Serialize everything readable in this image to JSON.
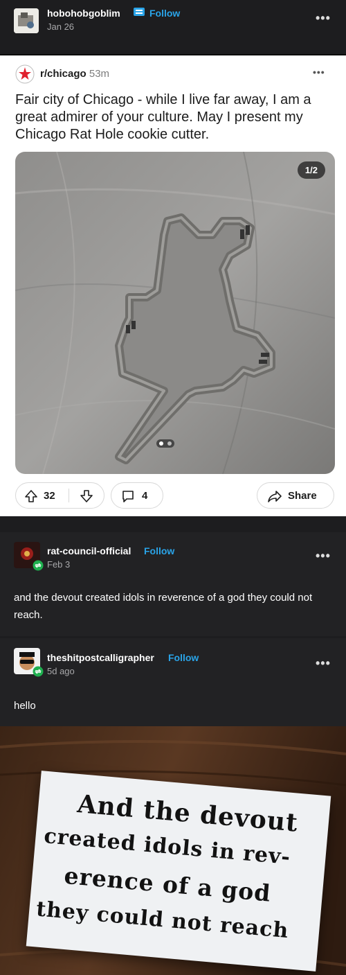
{
  "original_post": {
    "username": "hobohobgoblim",
    "follow_label": "Follow",
    "date": "Jan 26",
    "more_label": "•••"
  },
  "reddit": {
    "subreddit": "r/chicago",
    "time": "53m",
    "more_label": "•••",
    "title": "Fair city of Chicago - while I live far away, I am a great admirer of your culture. May I present my Chicago Rat Hole cookie cutter.",
    "image_counter": "1/2",
    "upvotes": "32",
    "comments": "4",
    "share_label": "Share"
  },
  "reblog1": {
    "username": "rat-council-official",
    "follow_label": "Follow",
    "date": "Feb 3",
    "more_label": "•••",
    "text": "and the devout created idols in reverence of a god they could not reach."
  },
  "reblog2": {
    "username": "theshitpostcalligrapher",
    "follow_label": "Follow",
    "date": "5d ago",
    "more_label": "•••",
    "text": "hello",
    "calligraphy_lines": [
      "And the devout",
      "created idols in rev-",
      "erence of a god",
      "they could not reach"
    ]
  }
}
